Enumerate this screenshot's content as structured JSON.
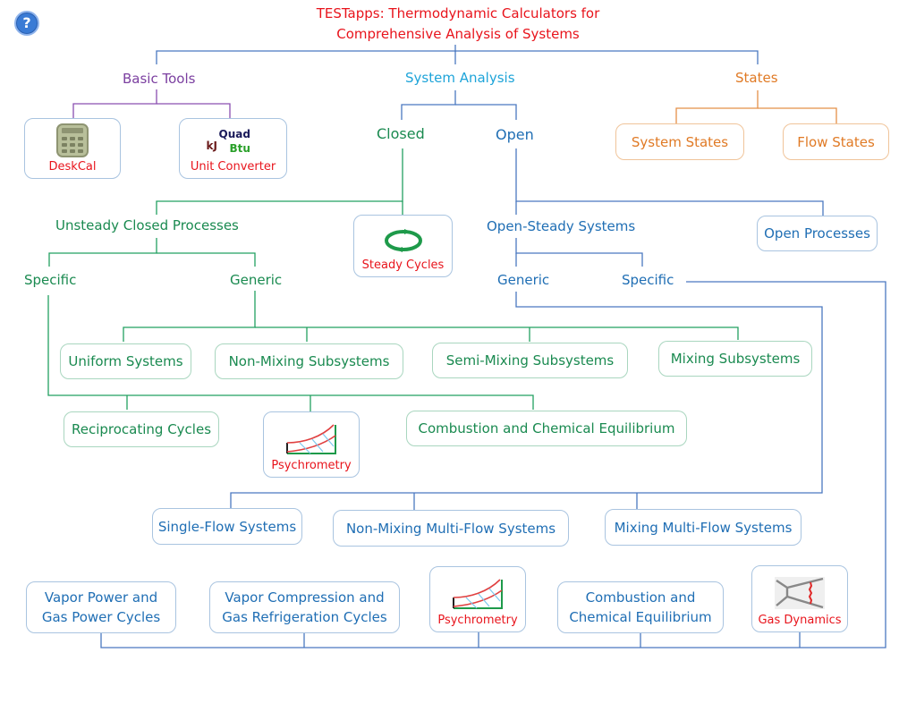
{
  "header": {
    "title_line1": "TESTapps: Thermodynamic Calculators  for",
    "title_line2": "Comprehensive Analysis of Systems",
    "help_icon": "question-mark-circle-icon",
    "help_glyph": "?"
  },
  "colors": {
    "title": "#e8141c",
    "basic_tools": "#7b3fa0",
    "system_analysis": "#1ea4d9",
    "closed": "#1a8a50",
    "open": "#1f6eb4",
    "states": "#e07a25",
    "app_label": "#e8141c"
  },
  "basic_tools": {
    "label": "Basic Tools",
    "deskcal": {
      "label": "DeskCal",
      "icon": "calculator-icon"
    },
    "unit_converter": {
      "label": "Unit Converter",
      "icon": "unit-converter-icon",
      "icon_text": {
        "quad": "Quad",
        "kj": "kJ",
        "btu": "Btu"
      }
    }
  },
  "system_analysis": {
    "label": "System Analysis",
    "closed": {
      "label": "Closed",
      "unsteady": {
        "label": "Unsteady Closed Processes",
        "specific": {
          "label": "Specific",
          "items": [
            "Reciprocating Cycles",
            "Psychrometry",
            "Combustion and Chemical Equilibrium"
          ]
        },
        "generic": {
          "label": "Generic",
          "items": [
            "Uniform Systems",
            "Non-Mixing Subsystems",
            "Semi-Mixing Subsystems",
            "Mixing Subsystems"
          ]
        }
      },
      "steady_cycles": {
        "label": "Steady  Cycles",
        "icon": "cycle-arrows-icon"
      }
    },
    "open": {
      "label": "Open",
      "open_steady": {
        "label": "Open-Steady Systems",
        "generic": {
          "label": "Generic",
          "items": [
            "Single-Flow Systems",
            "Non-Mixing Multi-Flow Systems",
            "Mixing Multi-Flow Systems"
          ]
        },
        "specific": {
          "label": "Specific",
          "items": [
            {
              "line1": "Vapor Power and",
              "line2": "Gas Power Cycles"
            },
            {
              "line1": "Vapor Compression and",
              "line2": "Gas Refrigeration Cycles"
            },
            {
              "label": "Psychrometry",
              "icon": "psychrometric-chart-icon"
            },
            {
              "line1": "Combustion and",
              "line2": "Chemical Equilibrium"
            },
            {
              "label": "Gas Dynamics",
              "icon": "nozzle-shock-icon"
            }
          ]
        }
      },
      "open_processes": {
        "label": "Open Processes"
      }
    }
  },
  "states": {
    "label": "States",
    "system_states": "System States",
    "flow_states": "Flow States"
  }
}
